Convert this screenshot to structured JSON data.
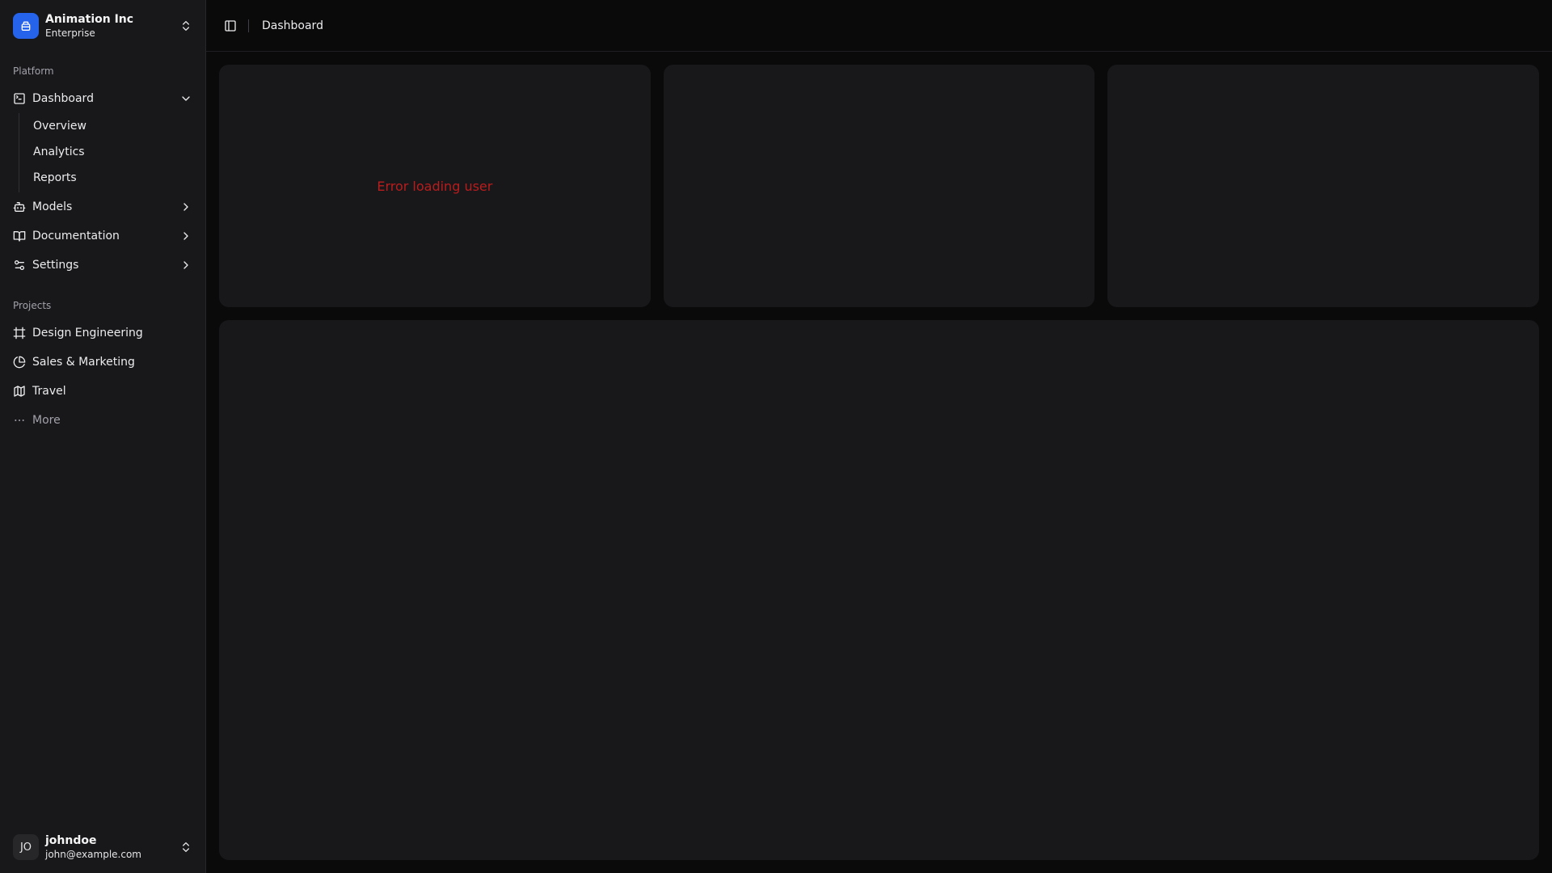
{
  "team": {
    "name": "Animation Inc",
    "plan": "Enterprise",
    "logo_color": "#2563eb"
  },
  "sidebar": {
    "platform_label": "Platform",
    "nav": [
      {
        "label": "Dashboard",
        "icon": "square-terminal-icon",
        "expanded": true,
        "sub": [
          "Overview",
          "Analytics",
          "Reports"
        ]
      },
      {
        "label": "Models",
        "icon": "bot-icon"
      },
      {
        "label": "Documentation",
        "icon": "book-open-icon"
      },
      {
        "label": "Settings",
        "icon": "settings-sliders-icon"
      }
    ],
    "projects_label": "Projects",
    "projects": [
      {
        "label": "Design Engineering",
        "icon": "frame-icon"
      },
      {
        "label": "Sales & Marketing",
        "icon": "pie-chart-icon"
      },
      {
        "label": "Travel",
        "icon": "map-icon"
      }
    ],
    "more_label": "More"
  },
  "user": {
    "initials": "JO",
    "name": "johndoe",
    "email": "john@example.com"
  },
  "header": {
    "breadcrumb": "Dashboard"
  },
  "main": {
    "card_error": "Error loading user",
    "error_color": "#b91c1c"
  }
}
